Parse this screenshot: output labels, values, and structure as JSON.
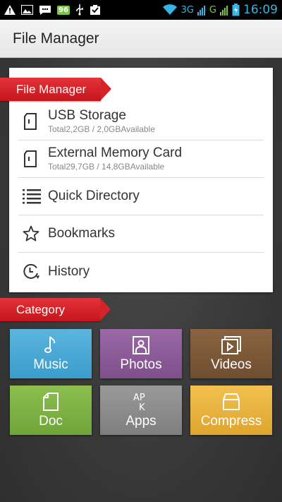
{
  "status_bar": {
    "icons": [
      "warning-icon",
      "image-icon",
      "message-icon",
      "battery-badge",
      "usb-icon",
      "clipboard-icon"
    ],
    "battery_badge": "96",
    "network_3g": "3G",
    "network_g": "G",
    "time": "16:09"
  },
  "action_bar": {
    "title": "File Manager"
  },
  "file_manager": {
    "section_label": "File Manager",
    "items": [
      {
        "label": "USB Storage",
        "sub": "Total2,2GB / 2,0GBAvailable",
        "icon": "sd-card-icon"
      },
      {
        "label": "External Memory Card",
        "sub": "Total29,7GB / 14,8GBAvailable",
        "icon": "sd-card-icon"
      },
      {
        "label": "Quick Directory",
        "icon": "list-icon"
      },
      {
        "label": "Bookmarks",
        "icon": "star-icon"
      },
      {
        "label": "History",
        "icon": "history-icon"
      }
    ]
  },
  "category": {
    "section_label": "Category",
    "tiles": [
      {
        "label": "Music",
        "icon": "music-icon",
        "color": "#4aa9d6"
      },
      {
        "label": "Photos",
        "icon": "photo-icon",
        "color": "#8c5d99"
      },
      {
        "label": "Videos",
        "icon": "video-icon",
        "color": "#7d5938"
      },
      {
        "label": "Doc",
        "icon": "doc-icon",
        "color": "#7db244"
      },
      {
        "label": "Apps",
        "icon": "apk-icon",
        "apk_text": "APK",
        "color": "#8c8c8c"
      },
      {
        "label": "Compress",
        "icon": "archive-icon",
        "color": "#e9b13c"
      }
    ]
  }
}
